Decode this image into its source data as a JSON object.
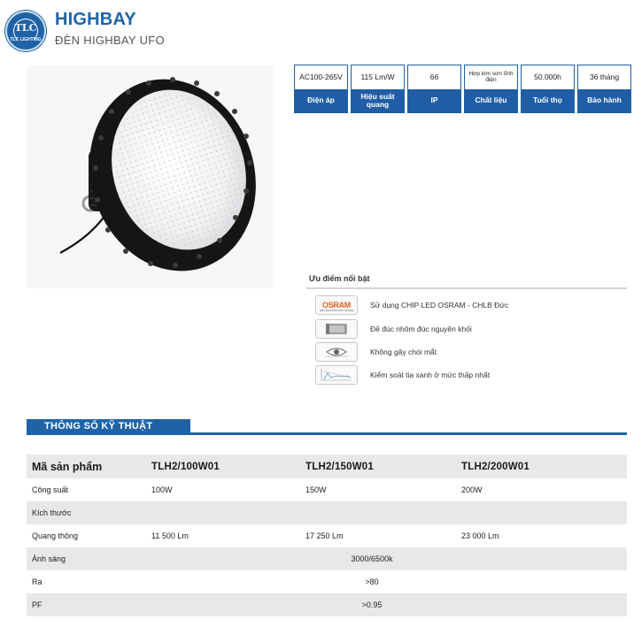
{
  "header": {
    "logo_text": "TLC",
    "logo_sub": "TLC LIGHTING",
    "title": "HIGHBAY",
    "subtitle": "ĐÈN HIGHBAY UFO"
  },
  "spec_cards": [
    {
      "value": "AC100-265V",
      "label": "Điện áp"
    },
    {
      "value": "115 Lm/W",
      "label": "Hiệu suất quang"
    },
    {
      "value": "66",
      "label": "IP"
    },
    {
      "value": "Hợp kim sơn tĩnh điện",
      "label": "Chất liệu"
    },
    {
      "value": "50.000h",
      "label": "Tuổi thọ"
    },
    {
      "value": "36 tháng",
      "label": "Bảo hành"
    }
  ],
  "advantages": {
    "title": "Ưu điểm nổi bật",
    "osram_logo": "OSRAM",
    "osram_logo_sub": "LED TECHNOLOGY INSIDE",
    "items": [
      {
        "icon": "osram-logo-icon",
        "text": "Sử dụng CHIP LED OSRAM - CHLB Đức"
      },
      {
        "icon": "aluminum-body-icon",
        "text": "Đế đúc nhôm đúc nguyên khối"
      },
      {
        "icon": "eye-icon",
        "text": "Không gây chói mắt"
      },
      {
        "icon": "blue-light-icon",
        "text": "Kiểm soát tia xanh ở mức thấp nhất"
      }
    ]
  },
  "spec_section": {
    "title": "THÔNG SỐ KỸ THUẬT",
    "header": [
      "Mã sản phẩm",
      "TLH2/100W01",
      "TLH2/150W01",
      "TLH2/200W01"
    ],
    "rows": [
      {
        "label": "Công suất",
        "values": [
          "100W",
          "150W",
          "200W"
        ]
      },
      {
        "label": "Kích thước",
        "values": [
          "",
          "",
          ""
        ]
      },
      {
        "label": "Quang thông",
        "values": [
          "11 500 Lm",
          "17 250 Lm",
          "23 000 Lm"
        ]
      },
      {
        "label": "Ánh sáng",
        "merged": "3000/6500k"
      },
      {
        "label": "Ra",
        "merged": ">80"
      },
      {
        "label": "PF",
        "merged": ">0.95"
      }
    ]
  },
  "colors": {
    "brand_blue": "#1f63a6",
    "osram_orange": "#e4611f",
    "row_shade": "#e8e8e8"
  }
}
